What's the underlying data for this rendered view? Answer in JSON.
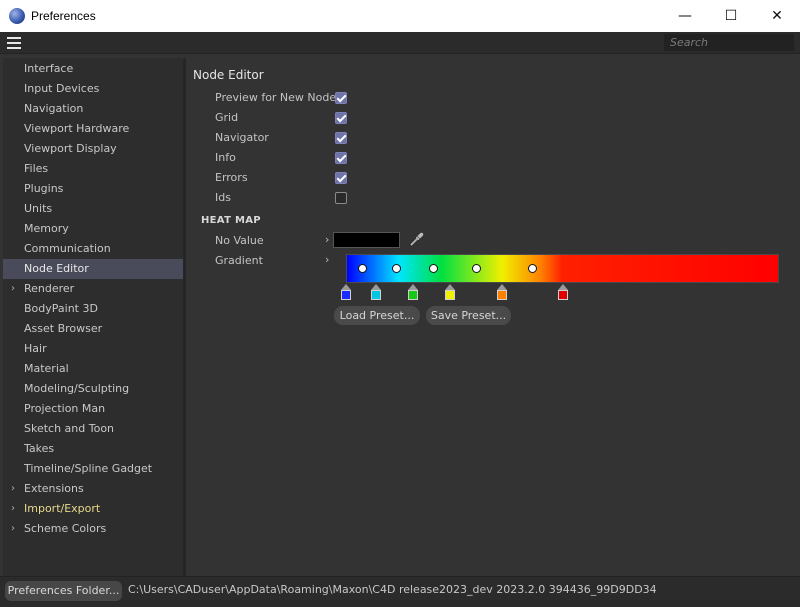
{
  "window": {
    "title": "Preferences",
    "minimize_glyph": "—",
    "maximize_glyph": "☐",
    "close_glyph": "✕"
  },
  "toolbar": {
    "search_placeholder": "Search"
  },
  "sidebar": {
    "items": [
      {
        "label": "Interface"
      },
      {
        "label": "Input Devices"
      },
      {
        "label": "Navigation"
      },
      {
        "label": "Viewport Hardware"
      },
      {
        "label": "Viewport Display"
      },
      {
        "label": "Files"
      },
      {
        "label": "Plugins"
      },
      {
        "label": "Units"
      },
      {
        "label": "Memory"
      },
      {
        "label": "Communication"
      },
      {
        "label": "Node Editor",
        "selected": true
      },
      {
        "label": "Renderer",
        "expandable": true
      },
      {
        "label": "BodyPaint 3D"
      },
      {
        "label": "Asset Browser"
      },
      {
        "label": "Hair"
      },
      {
        "label": "Material"
      },
      {
        "label": "Modeling/Sculpting"
      },
      {
        "label": "Projection Man"
      },
      {
        "label": "Sketch and Toon"
      },
      {
        "label": "Takes"
      },
      {
        "label": "Timeline/Spline Gadget"
      },
      {
        "label": "Extensions",
        "expandable": true
      },
      {
        "label": "Import/Export",
        "expandable": true,
        "highlight": true
      },
      {
        "label": "Scheme Colors",
        "expandable": true
      }
    ]
  },
  "node_editor": {
    "title": "Node Editor",
    "options": [
      {
        "label": "Preview for New Nodes",
        "checked": true
      },
      {
        "label": "Grid",
        "checked": true
      },
      {
        "label": "Navigator",
        "checked": true
      },
      {
        "label": "Info",
        "checked": true
      },
      {
        "label": "Errors",
        "checked": true
      },
      {
        "label": "Ids",
        "checked": false
      }
    ],
    "heat_map": {
      "title": "HEAT MAP",
      "no_value_label": "No Value",
      "no_value_color": "#000000",
      "gradient_label": "Gradient",
      "gradient_stops": [
        {
          "color": "#1a2bff",
          "position": 0.0
        },
        {
          "color": "#00c8e0",
          "position": 0.07
        },
        {
          "color": "#14c814",
          "position": 0.155
        },
        {
          "color": "#f0f000",
          "position": 0.24
        },
        {
          "color": "#ff8000",
          "position": 0.36
        },
        {
          "color": "#e00000",
          "position": 0.5
        }
      ],
      "knots": [
        0.037,
        0.115,
        0.2,
        0.3,
        0.43
      ]
    },
    "load_preset": "Load Preset...",
    "save_preset": "Save Preset..."
  },
  "statusbar": {
    "folder_button": "Preferences Folder...",
    "path": "C:\\Users\\CADuser\\AppData\\Roaming\\Maxon\\C4D release2023_dev 2023.2.0 394436_99D9DD34"
  }
}
